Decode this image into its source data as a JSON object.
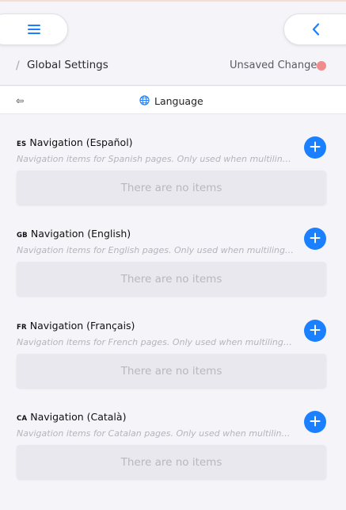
{
  "header": {
    "breadcrumb_separator": "/",
    "title": "Global Settings",
    "status_text": "Unsaved Changes",
    "status_color": "#f08c8c",
    "accent_color": "#1a80ff"
  },
  "toolbar": {
    "menu_icon": "hamburger-menu-icon",
    "back_icon": "chevron-left-icon"
  },
  "language_bar": {
    "toggle_glyph": "⇦",
    "toggle_icon": "swap-arrows-icon",
    "globe_icon": "globe-icon",
    "label": "Language"
  },
  "sections": [
    {
      "code": "ES",
      "title": "Navigation (Español)",
      "description": "Navigation items for Spanish pages. Only used when multilingual mode is enabled.",
      "empty_text": "There are no items"
    },
    {
      "code": "GB",
      "title": "Navigation (English)",
      "description": "Navigation items for English pages. Only used when multilingual mode is enabled.",
      "empty_text": "There are no items"
    },
    {
      "code": "FR",
      "title": "Navigation (Français)",
      "description": "Navigation items for French pages. Only used when multilingual mode is enabled.",
      "empty_text": "There are no items"
    },
    {
      "code": "CA",
      "title": "Navigation (Català)",
      "description": "Navigation items for Catalan pages. Only used when multilingual mode is enabled.",
      "empty_text": "There are no items"
    }
  ]
}
